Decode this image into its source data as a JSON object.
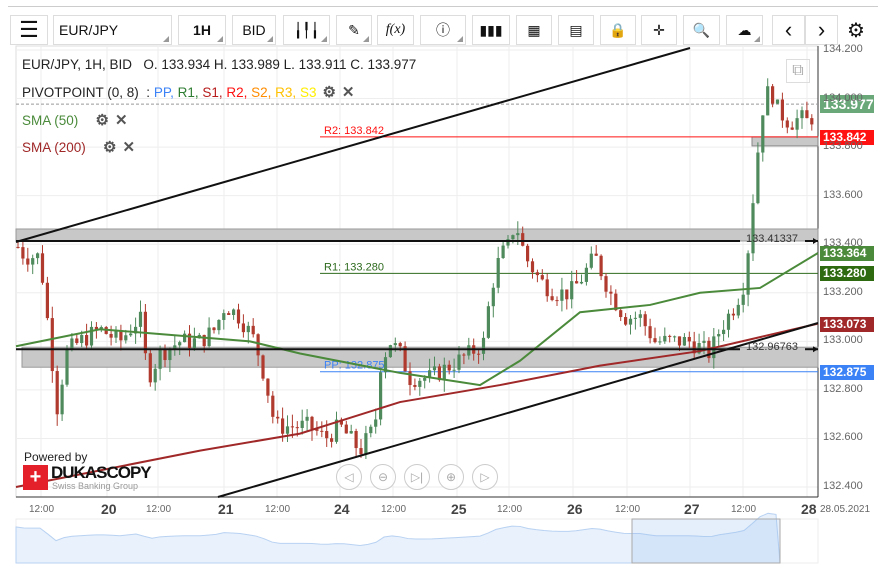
{
  "toolbar": {
    "instrument": "EUR/JPY",
    "timeframe": "1H",
    "side": "BID",
    "fx": "f(x)",
    "prev": "‹",
    "next": "›"
  },
  "legend": {
    "header": "EUR/JPY, 1H, BID",
    "ohlc": "O. 133.934 H. 133.989 L. 133.911 C. 133.977",
    "pivot_name": "PIVOTPOINT (0, 8)",
    "pivot_sep": ":",
    "pivot_items": [
      {
        "t": "PP",
        "c": "#3b82f6"
      },
      {
        "t": "R1",
        "c": "#2e7d32"
      },
      {
        "t": "S1",
        "c": "#b71c1c"
      },
      {
        "t": "R2",
        "c": "#ff1111"
      },
      {
        "t": "S2",
        "c": "#ff8c00"
      },
      {
        "t": "R3",
        "c": "#ffc000"
      },
      {
        "t": "S3",
        "c": "#ffee00"
      }
    ],
    "sma50": "SMA (50)",
    "sma200": "SMA (200)"
  },
  "levels": {
    "r2": {
      "label": "R2: 133.842",
      "value": 133.842,
      "color": "#ff1111"
    },
    "r1": {
      "label": "R1: 133.280",
      "value": 133.28,
      "color": "#2e6b1e"
    },
    "pp": {
      "label": "PP: 132.875",
      "value": 132.875,
      "color": "#3b82f6"
    },
    "h1": {
      "label": "133.41337",
      "value": 133.41337
    },
    "h2": {
      "label": "132.96763",
      "value": 132.96763
    }
  },
  "price_labels": [
    {
      "v": "133.977",
      "c": "#6aa87a"
    },
    {
      "v": "133.842",
      "c": "#ff1111"
    },
    {
      "v": "133.364",
      "c": "#4a8a3a"
    },
    {
      "v": "133.280",
      "c": "#2e6b10"
    },
    {
      "v": "133.073",
      "c": "#a02828"
    },
    {
      "v": "132.875",
      "c": "#3b82f6"
    }
  ],
  "y_axis": [
    "134.200",
    "134.000",
    "133.800",
    "133.600",
    "133.400",
    "133.200",
    "133.000",
    "132.800",
    "132.600",
    "132.400"
  ],
  "x_axis": {
    "days": [
      "20",
      "21",
      "24",
      "25",
      "26",
      "27",
      "28"
    ],
    "hour": "12:00",
    "date": "28.05.2021"
  },
  "branding": {
    "powered": "Powered by",
    "logo": "DUKASCOPY",
    "sub": "Swiss Banking Group"
  },
  "chart_data": {
    "type": "candlestick",
    "current": 133.977,
    "path": [
      [
        16,
        133.4
      ],
      [
        25,
        133.35
      ],
      [
        40,
        133.35
      ],
      [
        50,
        133.0
      ],
      [
        58,
        132.7
      ],
      [
        65,
        132.95
      ],
      [
        80,
        133.0
      ],
      [
        100,
        133.05
      ],
      [
        120,
        133.0
      ],
      [
        140,
        133.1
      ],
      [
        148,
        132.85
      ],
      [
        160,
        132.95
      ],
      [
        180,
        133.0
      ],
      [
        200,
        133.0
      ],
      [
        215,
        133.05
      ],
      [
        225,
        133.15
      ],
      [
        240,
        133.1
      ],
      [
        255,
        133.0
      ],
      [
        265,
        132.85
      ],
      [
        275,
        132.65
      ],
      [
        290,
        132.65
      ],
      [
        310,
        132.65
      ],
      [
        325,
        132.6
      ],
      [
        340,
        132.65
      ],
      [
        360,
        132.55
      ],
      [
        375,
        132.65
      ],
      [
        380,
        132.9
      ],
      [
        390,
        133.0
      ],
      [
        400,
        132.95
      ],
      [
        410,
        132.85
      ],
      [
        430,
        132.85
      ],
      [
        450,
        132.9
      ],
      [
        470,
        132.95
      ],
      [
        485,
        133.0
      ],
      [
        490,
        133.2
      ],
      [
        500,
        133.35
      ],
      [
        510,
        133.4
      ],
      [
        515,
        133.5
      ],
      [
        525,
        133.35
      ],
      [
        540,
        133.25
      ],
      [
        555,
        133.2
      ],
      [
        570,
        133.2
      ],
      [
        580,
        133.25
      ],
      [
        595,
        133.35
      ],
      [
        610,
        133.2
      ],
      [
        625,
        133.1
      ],
      [
        640,
        133.1
      ],
      [
        655,
        133.0
      ],
      [
        670,
        133.0
      ],
      [
        690,
        133.0
      ],
      [
        710,
        132.95
      ],
      [
        720,
        133.05
      ],
      [
        735,
        133.15
      ],
      [
        745,
        133.25
      ],
      [
        752,
        133.55
      ],
      [
        757,
        133.75
      ],
      [
        762,
        133.95
      ],
      [
        770,
        134.05
      ],
      [
        778,
        133.95
      ],
      [
        790,
        133.9
      ],
      [
        800,
        133.92
      ],
      [
        810,
        133.9
      ],
      [
        816,
        133.977
      ]
    ],
    "sma50": [
      [
        16,
        132.98
      ],
      [
        100,
        133.05
      ],
      [
        250,
        133.0
      ],
      [
        300,
        132.95
      ],
      [
        400,
        132.87
      ],
      [
        480,
        132.82
      ],
      [
        520,
        132.92
      ],
      [
        580,
        133.12
      ],
      [
        650,
        133.15
      ],
      [
        700,
        133.2
      ],
      [
        760,
        133.22
      ],
      [
        818,
        133.364
      ]
    ],
    "sma200": [
      [
        16,
        132.4
      ],
      [
        200,
        132.55
      ],
      [
        300,
        132.62
      ],
      [
        400,
        132.75
      ],
      [
        500,
        132.82
      ],
      [
        600,
        132.9
      ],
      [
        700,
        132.96
      ],
      [
        818,
        133.073
      ]
    ],
    "colors": {
      "up": "#4e8a5c",
      "down": "#b03a2e",
      "sma50": "#4a8a3a",
      "sma200": "#a02828"
    }
  }
}
